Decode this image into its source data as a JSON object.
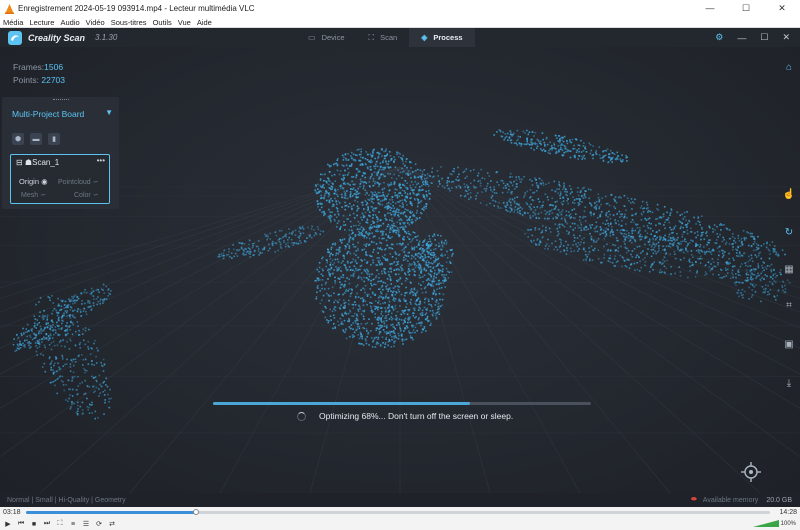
{
  "vlc": {
    "window_title": "Enregistrement 2024-05-19 093914.mp4 - Lecteur multimédia VLC",
    "menu": [
      "Média",
      "Lecture",
      "Audio",
      "Vidéo",
      "Sous-titres",
      "Outils",
      "Vue",
      "Aide"
    ],
    "elapsed": "03:18",
    "total": "14:28",
    "position_fraction": 0.228,
    "volume": "100%"
  },
  "app": {
    "name": "Creality Scan",
    "version": "3.1.30",
    "tabs": [
      {
        "label": "Device",
        "icon": "monitor-icon",
        "active": false
      },
      {
        "label": "Scan",
        "icon": "scan-icon",
        "active": false
      },
      {
        "label": "Process",
        "icon": "layers-icon",
        "active": true
      }
    ]
  },
  "stats": {
    "frames_label": "Frames:",
    "frames_value": "1506",
    "points_label": "Points:",
    "points_value": "22703"
  },
  "board": {
    "title": "Multi-Project Board",
    "scan_name": "Scan_1",
    "origin_label": "Origin",
    "pointcloud_label": "Pointcloud",
    "mesh_label": "Mesh",
    "color_label": "Color"
  },
  "progress": {
    "fraction": 0.68,
    "text": "Optimizing 68%... Don't turn off the screen or sleep."
  },
  "footer": {
    "modes": "Normal | Small | Hi-Quality | Geometry",
    "memory_label": "Available memory",
    "memory_value": "20.0 GB"
  },
  "colors": {
    "accent": "#5cc3f2",
    "pointcloud": "#3ea7dd"
  }
}
